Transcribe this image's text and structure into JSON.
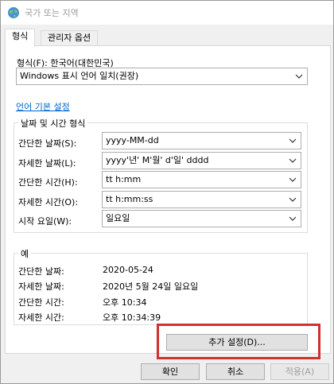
{
  "window": {
    "title": "국가 또는 지역"
  },
  "tabs": [
    {
      "label": "형식",
      "active": true
    },
    {
      "label": "관리자 옵션",
      "active": false
    }
  ],
  "format": {
    "label": "형식(F): 한국어(대한민국)",
    "selected": "Windows 표시 언어 일치(권장)"
  },
  "language_link": "언어 기본 설정",
  "datetime_group": {
    "title": "날짜 및 시간 형식",
    "rows": [
      {
        "label": "간단한 날짜(S):",
        "value": "yyyy-MM-dd"
      },
      {
        "label": "자세한 날짜(L):",
        "value": "yyyy'년' M'월' d'일' dddd"
      },
      {
        "label": "간단한 시간(H):",
        "value": "tt h:mm"
      },
      {
        "label": "자세한 시간(O):",
        "value": "tt h:mm:ss"
      },
      {
        "label": "시작 요일(W):",
        "value": "일요일"
      }
    ]
  },
  "example_group": {
    "title": "예",
    "rows": [
      {
        "label": "간단한 날짜:",
        "value": "2020-05-24"
      },
      {
        "label": "자세한 날짜:",
        "value": "2020년 5월 24일 일요일"
      },
      {
        "label": "간단한 시간:",
        "value": "오후 10:34"
      },
      {
        "label": "자세한 시간:",
        "value": "오후 10:34:39"
      }
    ]
  },
  "buttons": {
    "additional_settings": "추가 설정(D)...",
    "ok": "확인",
    "cancel": "취소",
    "apply": "적용(A)"
  },
  "colors": {
    "highlight": "#d32f2f",
    "link": "#0066cc"
  },
  "icons": {
    "title": "globe-icon",
    "combo": "chevron-down-icon"
  }
}
